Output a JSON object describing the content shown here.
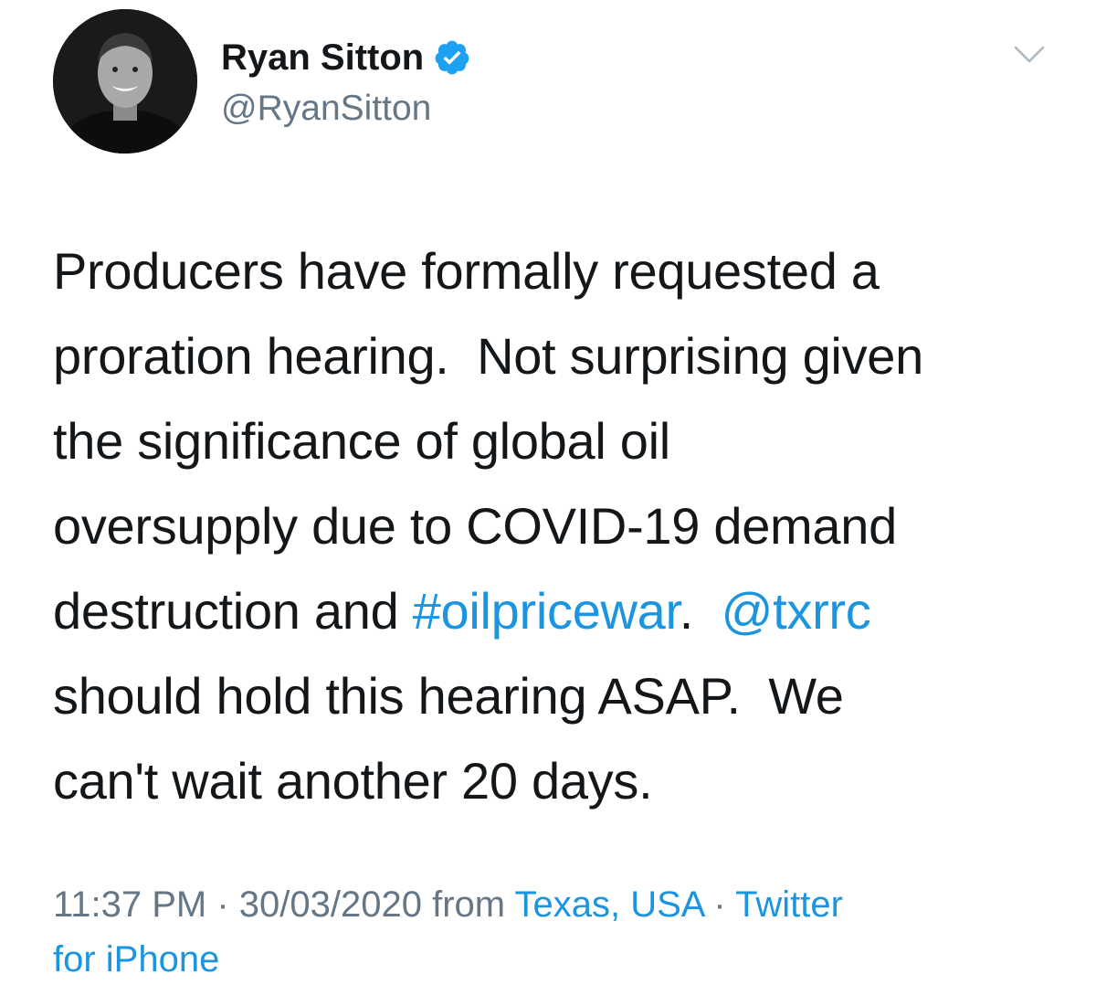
{
  "author": {
    "name": "Ryan Sitton",
    "handle": "@RyanSitton",
    "verified": true
  },
  "tweet": {
    "segments": [
      {
        "type": "text",
        "text": "Producers have formally requested a\nproration hearing.  Not surprising given\nthe significance of global oil\noversupply due to COVID-19 demand\ndestruction and "
      },
      {
        "type": "link",
        "text": "#oilpricewar"
      },
      {
        "type": "text",
        "text": ".  "
      },
      {
        "type": "link",
        "text": "@txrrc"
      },
      {
        "type": "text",
        "text": "\nshould hold this hearing ASAP.  We\ncan't wait another 20 days."
      }
    ]
  },
  "meta": {
    "time": "11:37 PM",
    "separator1": " · ",
    "date": "30/03/2020",
    "from_label": " from ",
    "location": "Texas, USA",
    "separator2": " · ",
    "source": "Twitter\nfor iPhone"
  },
  "icons": {
    "verified": "verified-badge-icon",
    "menu": "chevron-down-icon"
  },
  "colors": {
    "link": "#1b95e0",
    "secondary_text": "#657786",
    "primary_text": "#14171a",
    "verified_badge": "#1da1f2"
  }
}
